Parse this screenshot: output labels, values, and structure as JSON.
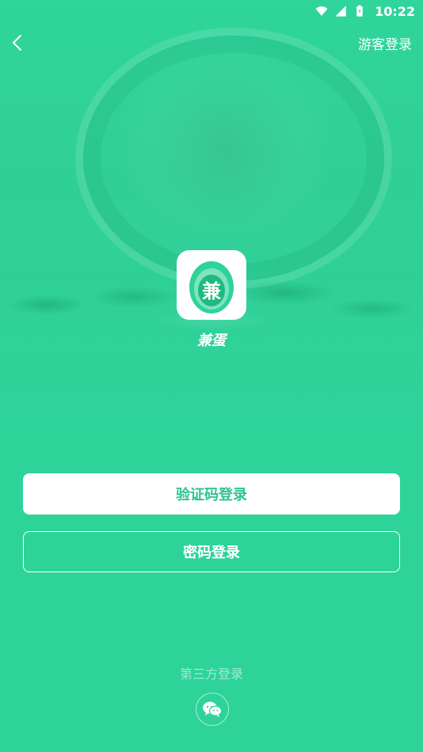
{
  "status_bar": {
    "time": "10:22",
    "icons": [
      "wifi-icon",
      "signal-icon",
      "battery-icon"
    ]
  },
  "header": {
    "back_icon": "chevron-left-icon",
    "guest_login_label": "游客登录"
  },
  "app": {
    "icon_glyph": "兼",
    "name": "兼蛋"
  },
  "buttons": {
    "code_login_label": "验证码登录",
    "password_login_label": "密码登录"
  },
  "third_party": {
    "label": "第三方登录",
    "wechat_icon": "wechat-icon"
  },
  "colors": {
    "brand": "#2ed39a",
    "primary_text": "#2ec48e",
    "white": "#ffffff"
  }
}
